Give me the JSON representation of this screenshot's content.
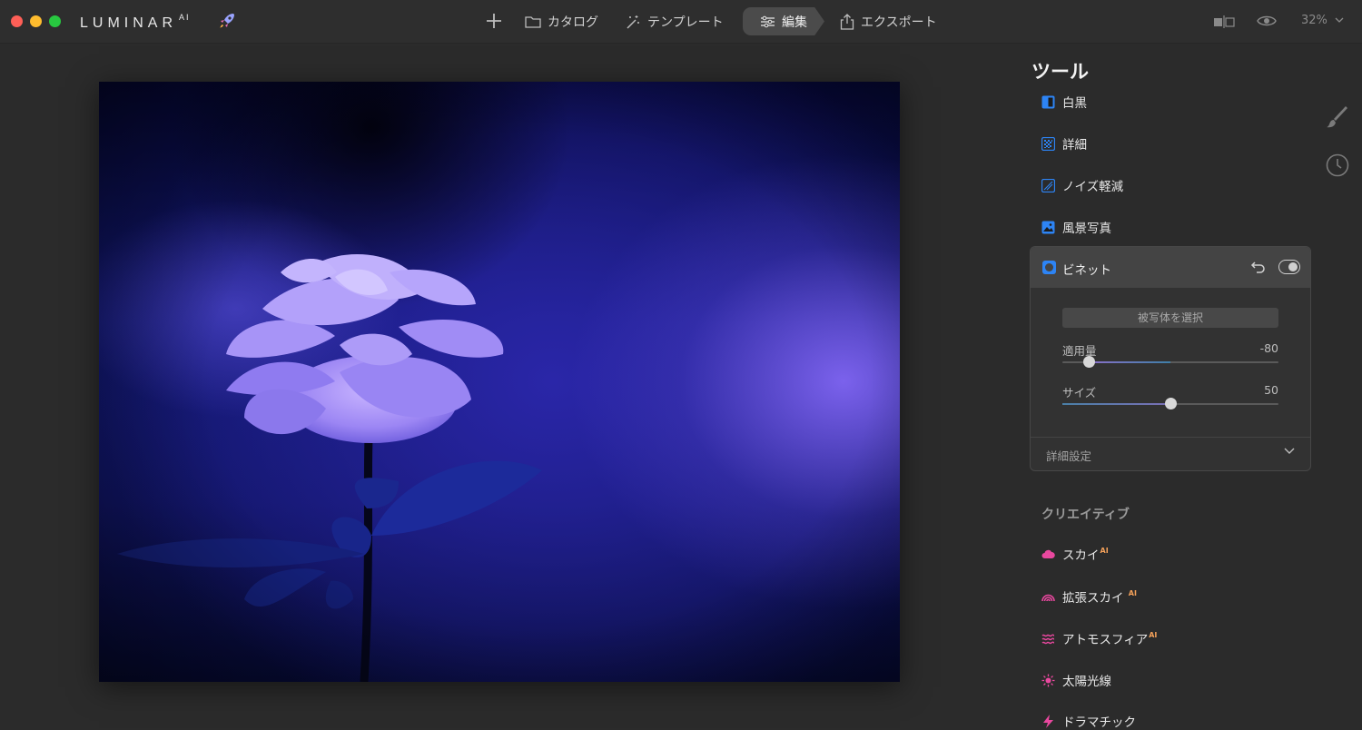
{
  "app": {
    "brand": "LUMINAR",
    "brand_suffix": "AI",
    "zoom": "32%"
  },
  "nav": {
    "catalog": "カタログ",
    "template": "テンプレート",
    "edit": "編集",
    "export": "エクスポート"
  },
  "panel": {
    "title": "ツール",
    "tools": [
      {
        "label": "白黒",
        "icon": "bw-icon"
      },
      {
        "label": "詳細",
        "icon": "details-icon"
      },
      {
        "label": "ノイズ軽減",
        "icon": "noise-icon"
      },
      {
        "label": "風景写真",
        "icon": "landscape-icon"
      }
    ],
    "vignette": {
      "title": "ビネット",
      "subject_button": "被写体を選択",
      "amount_label": "適用量",
      "amount_value": "-80",
      "amount_fraction": 0.12,
      "size_label": "サイズ",
      "size_value": "50",
      "size_fraction": 0.5,
      "advanced": "詳細設定",
      "enabled": true
    },
    "creative_section": "クリエイティブ",
    "creative_tools": [
      {
        "label": "スカイ",
        "ai": "AI"
      },
      {
        "label": "拡張スカイ",
        "ai": "AI"
      },
      {
        "label": "アトモスフィア",
        "ai": "AI"
      },
      {
        "label": "太陽光線",
        "ai": ""
      },
      {
        "label": "ドラマチック",
        "ai": ""
      }
    ]
  },
  "colors": {
    "accent_blue": "#2d84f5",
    "creative_pink": "#e9489f",
    "ai_orange": "#f4a15a"
  }
}
